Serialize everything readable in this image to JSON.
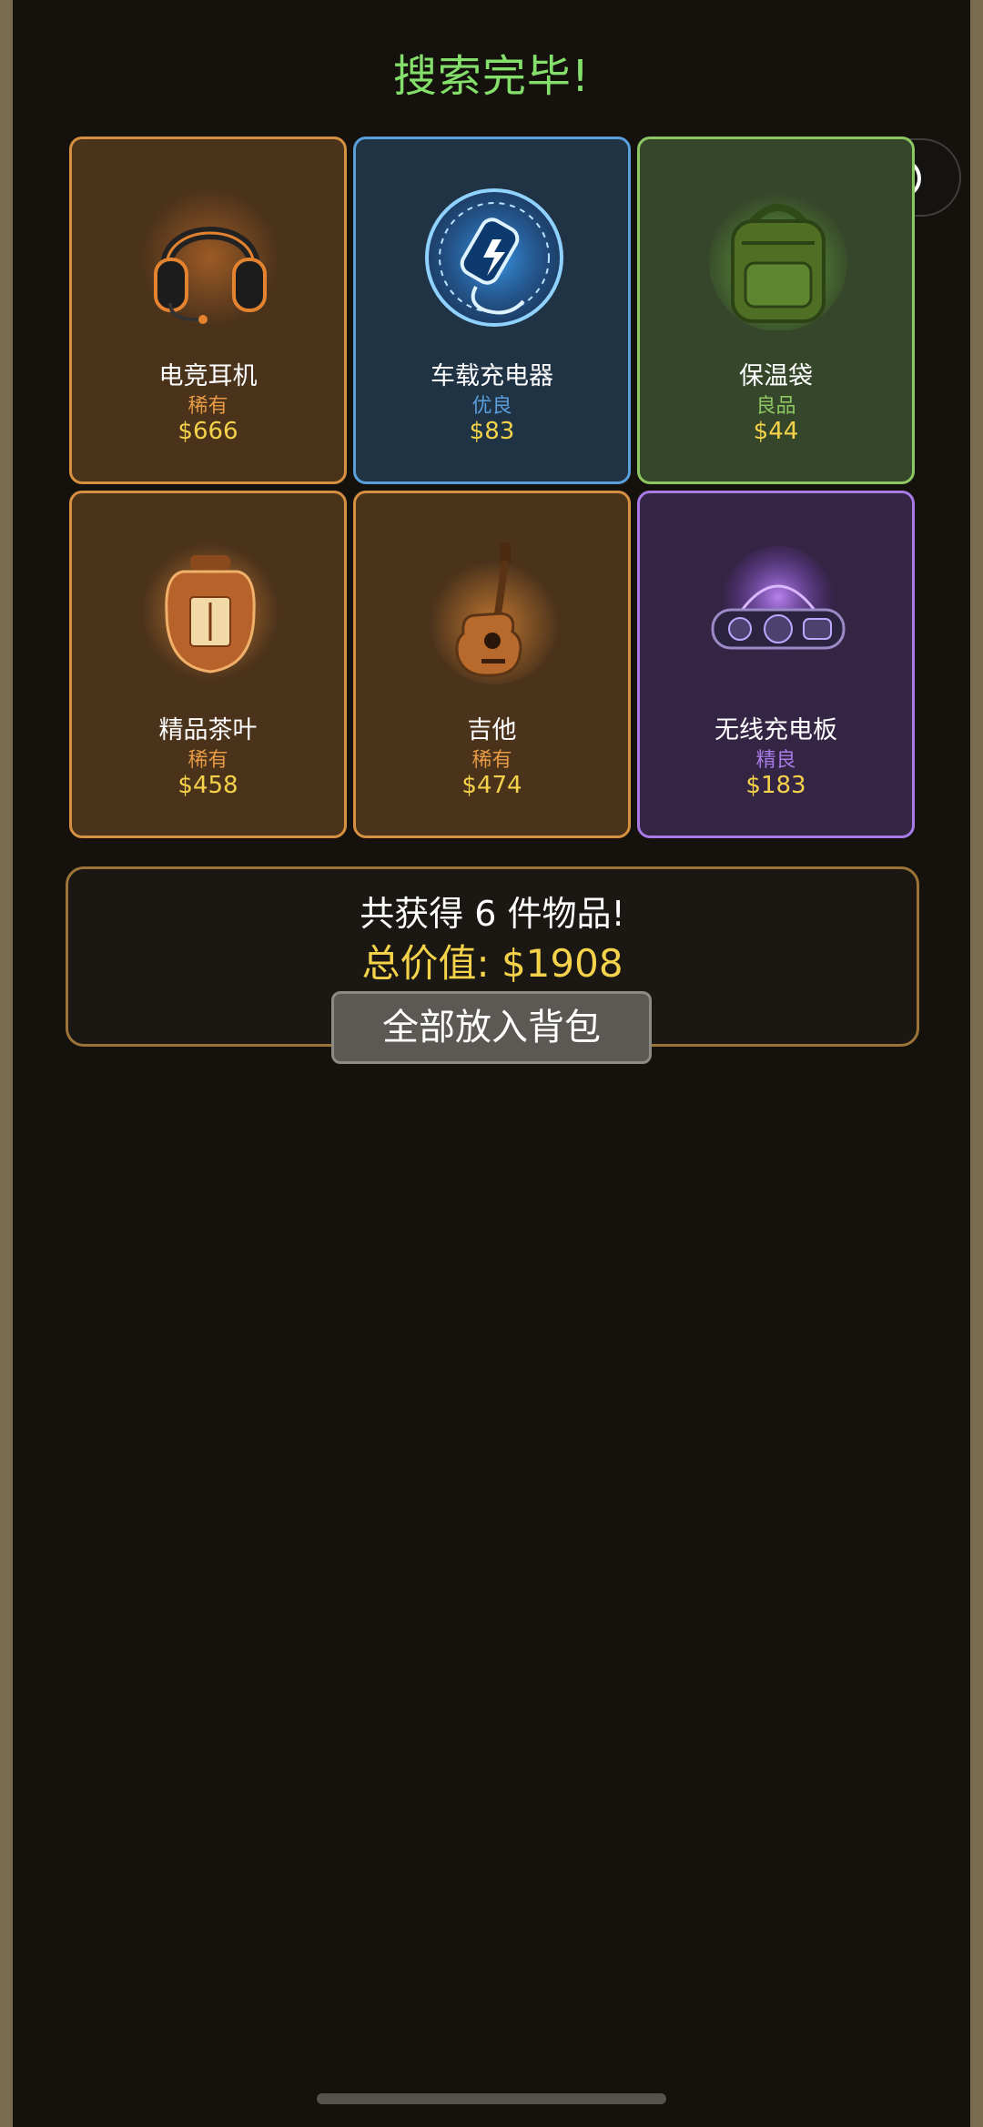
{
  "header": {
    "title": "搜索完毕!"
  },
  "capsule": {
    "more_icon": "more-dots-icon",
    "close_icon": "target-circle-icon"
  },
  "colors": {
    "rare": "#e79a45",
    "good": "#5b9edc",
    "fine": "#8cc763",
    "elite": "#a77ae6",
    "price": "#f4d24a",
    "title": "#84e06a"
  },
  "items": [
    {
      "name": "电竞耳机",
      "rarity": "稀有",
      "price": "$666",
      "icon": "gaming-headset-icon"
    },
    {
      "name": "车载充电器",
      "rarity": "优良",
      "price": "$83",
      "icon": "car-charger-icon"
    },
    {
      "name": "保温袋",
      "rarity": "良品",
      "price": "$44",
      "icon": "insulated-bag-icon"
    },
    {
      "name": "精品茶叶",
      "rarity": "稀有",
      "price": "$458",
      "icon": "tea-jar-icon"
    },
    {
      "name": "吉他",
      "rarity": "稀有",
      "price": "$474",
      "icon": "guitar-icon"
    },
    {
      "name": "无线充电板",
      "rarity": "精良",
      "price": "$183",
      "icon": "wireless-charging-pad-icon"
    }
  ],
  "summary": {
    "count_text": "共获得 6 件物品!",
    "total_text": "总价值: $1908",
    "store_button": "全部放入背包"
  }
}
